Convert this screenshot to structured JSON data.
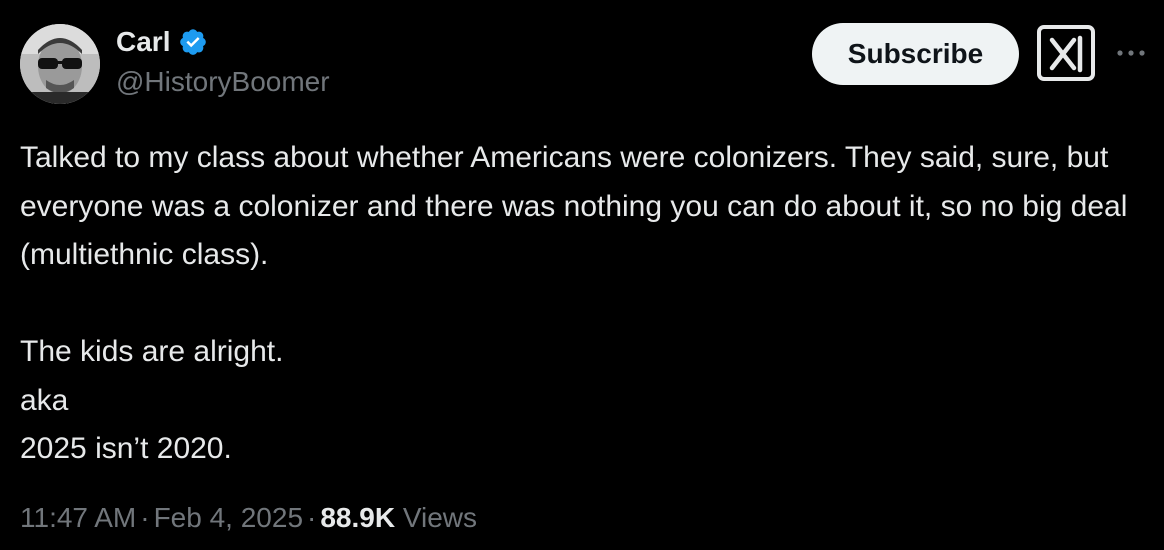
{
  "author": {
    "display_name": "Carl",
    "handle": "@HistoryBoomer",
    "verified": true
  },
  "actions": {
    "subscribe_label": "Subscribe",
    "grok_icon": "grok-icon",
    "more_icon": "more-icon"
  },
  "tweet": {
    "paragraph_1": "Talked to my class about whether Americans were colonizers. They said, sure, but everyone was a colonizer and there was nothing you can do about it, so no big deal (multiethnic class).",
    "line_1": "The kids are alright.",
    "line_2": "aka",
    "line_3": "2025 isn’t 2020."
  },
  "meta": {
    "time": "11:47 AM",
    "separator": "·",
    "date": "Feb 4, 2025",
    "views_count": "88.9K",
    "views_label": "Views"
  },
  "colors": {
    "background": "#000000",
    "text_primary": "#e7e9ea",
    "text_secondary": "#71767b",
    "verified_blue": "#1d9bf0",
    "button_bg": "#eff3f4"
  }
}
